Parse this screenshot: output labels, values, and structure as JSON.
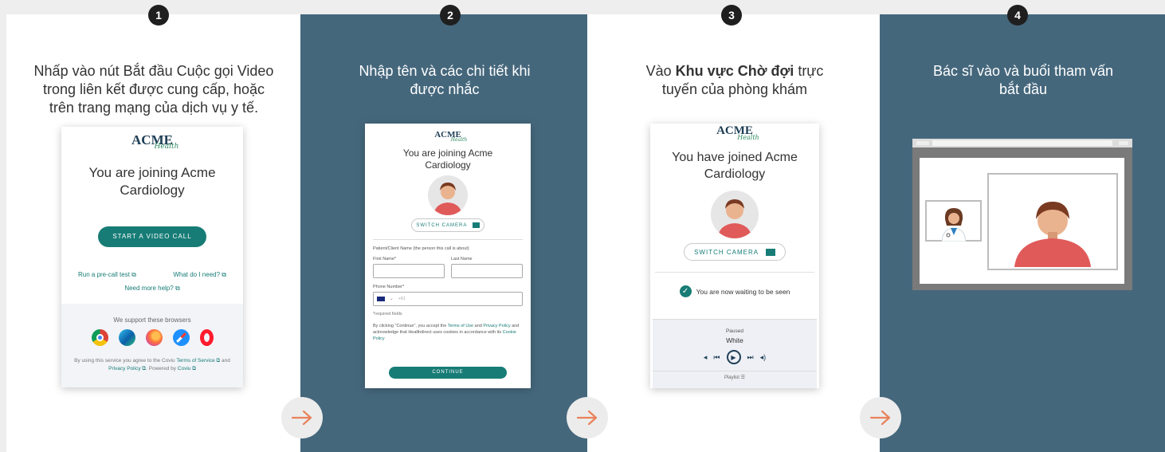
{
  "steps": [
    {
      "number": "1",
      "caption": "Nhấp vào nút Bắt đầu Cuộc gọi Video trong liên kết được cung cấp, hoặc trên trang mạng của dịch vụ y tế.",
      "mock": {
        "logo": "ACME",
        "logo_sub": "Health",
        "title": "You are joining Acme Cardiology",
        "start_button": "START A VIDEO CALL",
        "link_precall": "Run a pre-call test",
        "link_need": "What do I need?",
        "link_help": "Need more help?",
        "browsers_heading": "We support these browsers",
        "footer_prefix": "By using this service you agree to the Coviu",
        "footer_tos": "Terms of Service",
        "footer_and": "and",
        "footer_privacy": "Privacy Policy",
        "footer_powered": ". Powered by",
        "footer_coviu": "Coviu"
      }
    },
    {
      "number": "2",
      "caption": "Nhập tên và các chi tiết khi được nhắc",
      "mock": {
        "logo": "ACME",
        "logo_sub": "Health",
        "title": "You are joining Acme Cardiology",
        "switch_camera": "SWITCH CAMERA",
        "client_label": "Patient/Client Name (the person this call is about)",
        "first_name": "First Name*",
        "last_name": "Last Name",
        "phone_label": "Phone Number*",
        "phone_placeholder": "+61",
        "required": "*required fields",
        "consent_1": "By clicking \"Continue\", you accept the",
        "consent_tou": "Terms of Use",
        "consent_and": "and",
        "consent_privacy": "Privacy Policy",
        "consent_2": "and acknowledge that Healthdirect uses cookies in accordance with its",
        "consent_cookie": "Cookie Policy",
        "continue_button": "CONTINUE"
      }
    },
    {
      "number": "3",
      "caption_pre": "Vào ",
      "caption_bold": "Khu vực Chờ đợi",
      "caption_post": " trực tuyến của phòng khám",
      "mock": {
        "logo": "ACME",
        "logo_sub": "Health",
        "title": "You have joined Acme Cardiology",
        "switch_camera": "SWITCH CAMERA",
        "waiting": "You are now waiting to be seen",
        "player_status": "Paused",
        "player_track": "White",
        "playlist": "Playlist"
      }
    },
    {
      "number": "4",
      "caption": "Bác sĩ vào và buổi tham vấn bắt đầu"
    }
  ],
  "colors": {
    "panel_dark": "#45677c",
    "panel_light": "#ffffff",
    "accent_teal": "#177c76",
    "arrow": "#e8825c",
    "avatar_shirt": "#e05a5a",
    "avatar_hair": "#7a3a22"
  },
  "icons": [
    "arrow-right-icon",
    "camera-icon",
    "external-link-icon",
    "check-circle-icon",
    "play-icon",
    "volume-icon",
    "chrome-icon",
    "edge-icon",
    "firefox-icon",
    "safari-icon",
    "opera-icon",
    "doctor-icon",
    "patient-avatar-icon"
  ]
}
